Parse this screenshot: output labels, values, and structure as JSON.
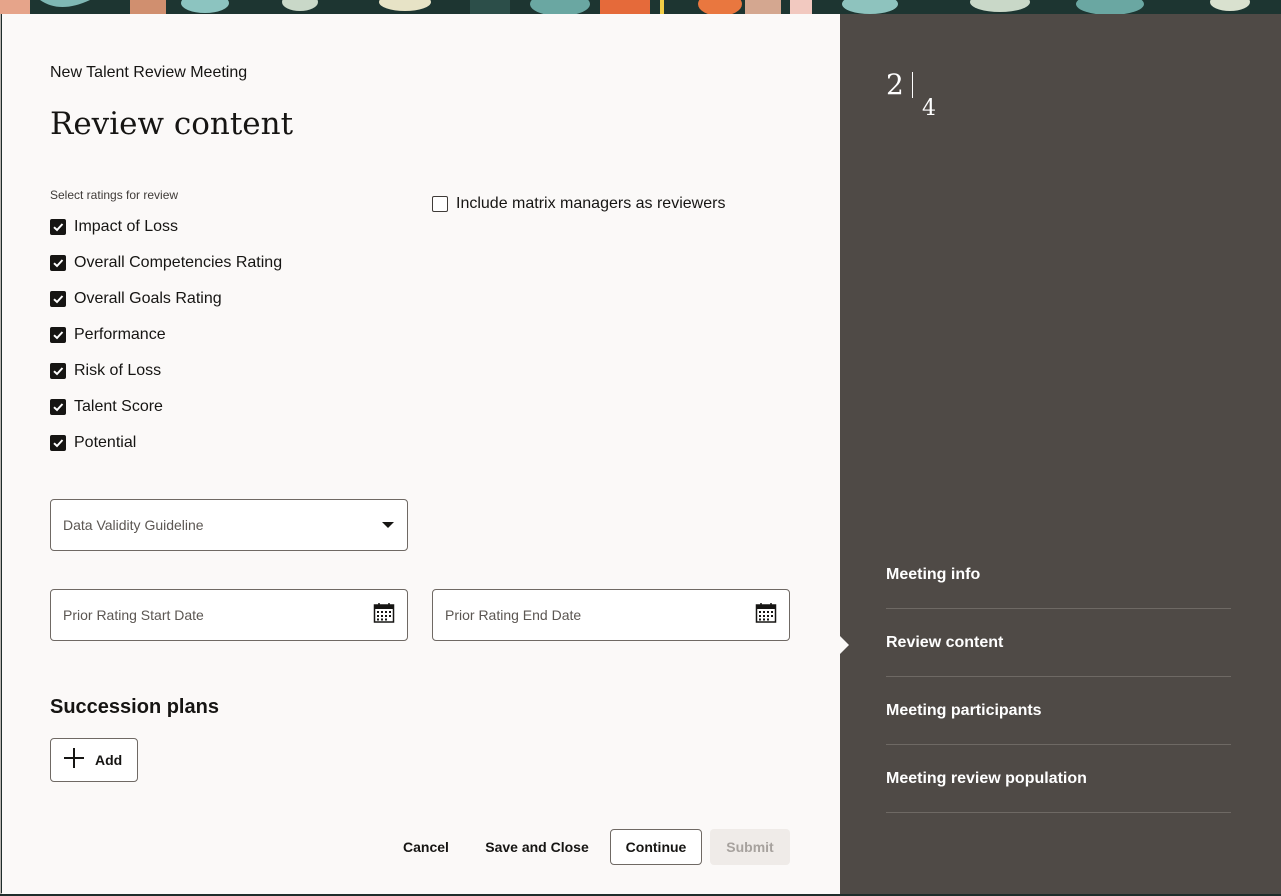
{
  "header": {
    "subtitle": "New Talent Review Meeting",
    "title": "Review content"
  },
  "ratings": {
    "label": "Select ratings for review",
    "items": [
      {
        "label": "Impact of Loss",
        "checked": true
      },
      {
        "label": "Overall Competencies Rating",
        "checked": true
      },
      {
        "label": "Overall Goals Rating",
        "checked": true
      },
      {
        "label": "Performance",
        "checked": true
      },
      {
        "label": "Risk of Loss",
        "checked": true
      },
      {
        "label": "Talent Score",
        "checked": true
      },
      {
        "label": "Potential",
        "checked": true
      }
    ]
  },
  "matrix": {
    "label": "Include matrix managers as reviewers",
    "checked": false
  },
  "fields": {
    "data_validity": "Data Validity Guideline",
    "prior_start": "Prior Rating Start Date",
    "prior_end": "Prior Rating End Date"
  },
  "succession": {
    "title": "Succession plans",
    "add_label": "Add"
  },
  "footer": {
    "cancel": "Cancel",
    "save_close": "Save and Close",
    "continue": "Continue",
    "submit": "Submit"
  },
  "steps": {
    "current": "2",
    "total": "4",
    "items": [
      {
        "label": "Meeting info"
      },
      {
        "label": "Review content"
      },
      {
        "label": "Meeting participants"
      },
      {
        "label": "Meeting review population"
      }
    ],
    "active": "Review content"
  },
  "colors": {
    "side_panel": "#4f4a46",
    "main_bg": "#fbf9f8",
    "checkbox": "#161513"
  }
}
